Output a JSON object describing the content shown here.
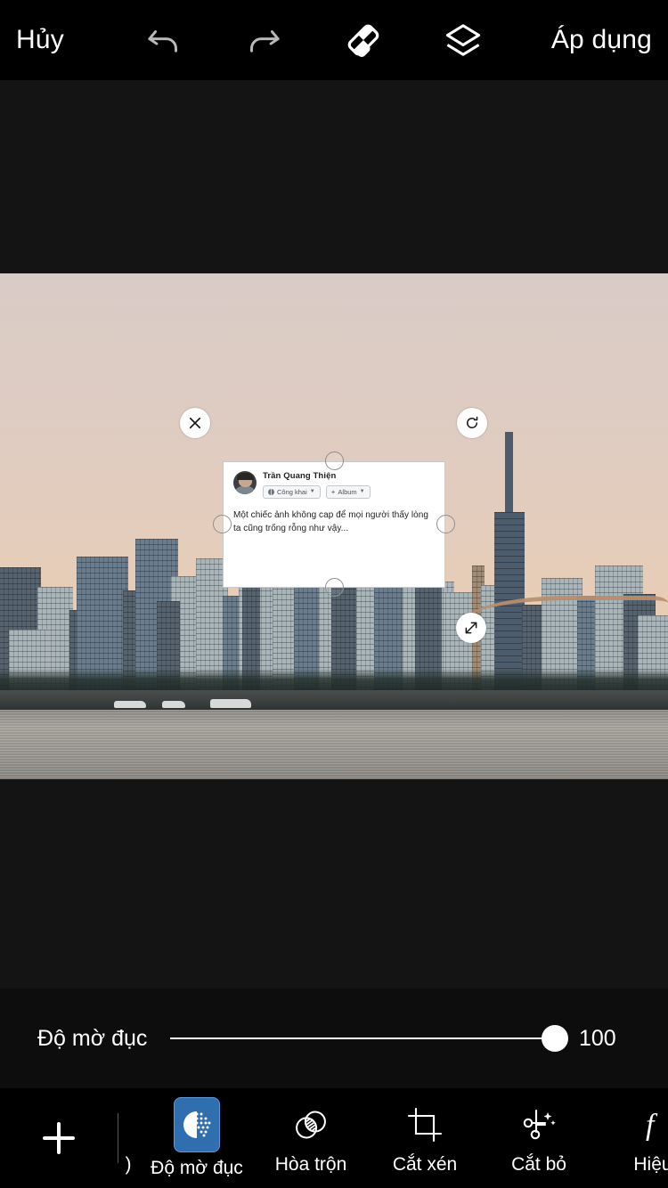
{
  "topbar": {
    "cancel_label": "Hủy",
    "apply_label": "Áp dụng",
    "icons": [
      {
        "name": "undo-icon",
        "label": "Hoàn tác"
      },
      {
        "name": "redo-icon",
        "label": "Làm lại"
      },
      {
        "name": "eraser-icon",
        "label": "Tẩy"
      },
      {
        "name": "layers-icon",
        "label": "Lớp"
      }
    ]
  },
  "canvas": {
    "photo_description": "Đường chân trời thành phố lúc hoàng hôn bên sông",
    "sky_color": "#e5cdbb",
    "water_color": "#9d9a93"
  },
  "sticker": {
    "author_name": "Trần Quang Thiện",
    "privacy_pill": "Công khai",
    "album_pill": "Album",
    "album_plus": "+",
    "post_text": "Một chiếc ảnh không cap để mọi người thấy lòng ta cũng trống rỗng như vậy...",
    "handles": {
      "close": "close-icon",
      "rotate": "rotate-icon",
      "resize": "resize-icon"
    }
  },
  "opacity": {
    "label": "Độ mờ đục",
    "value": "100",
    "min": 0,
    "max": 100
  },
  "toolbar": {
    "add_label": "Thêm",
    "clipped_label": ")",
    "tools": [
      {
        "label": "Độ mờ đục",
        "icon": "opacity-icon",
        "active": true
      },
      {
        "label": "Hòa trộn",
        "icon": "blend-icon",
        "active": false
      },
      {
        "label": "Cắt xén",
        "icon": "crop-icon",
        "active": false
      },
      {
        "label": "Cắt bỏ",
        "icon": "cutout-icon",
        "active": false
      },
      {
        "label": "Hiệu",
        "icon": "effects-icon",
        "active": false
      }
    ],
    "accent_color": "#2f6fb0"
  }
}
